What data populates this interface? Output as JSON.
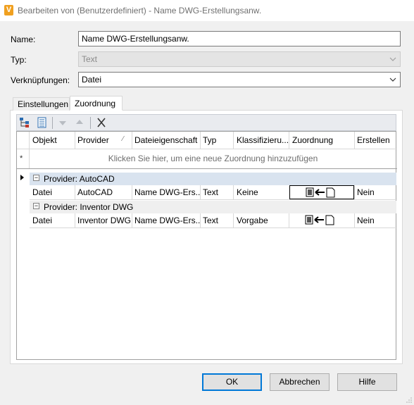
{
  "window": {
    "title": "Bearbeiten von (Benutzerdefiniert) - Name DWG-Erstellungsanw.",
    "app_icon_letter": "V"
  },
  "form": {
    "name_label": "Name:",
    "name_value": "Name DWG-Erstellungsanw.",
    "type_label": "Typ:",
    "type_value": "Text",
    "links_label": "Verknüpfungen:",
    "links_value": "Datei"
  },
  "tabs": [
    {
      "label": "Einstellungen",
      "active": false
    },
    {
      "label": "Zuordnung",
      "active": true
    }
  ],
  "grid": {
    "columns": [
      "Objekt",
      "Provider",
      "Dateieigenschaft",
      "Typ",
      "Klassifizieru...",
      "Zuordnung",
      "Erstellen"
    ],
    "new_row_marker": "*",
    "new_row_hint": "Klicken Sie hier, um eine neue Zuordnung hinzuzufügen",
    "groups": [
      {
        "header": "Provider: AutoCAD",
        "selected": true,
        "rows": [
          {
            "objekt": "Datei",
            "provider": "AutoCAD",
            "eigenschaft": "Name DWG-Ers...",
            "typ": "Text",
            "klass": "Keine",
            "erstellen": "Nein"
          }
        ]
      },
      {
        "header": "Provider: Inventor DWG",
        "selected": false,
        "rows": [
          {
            "objekt": "Datei",
            "provider": "Inventor DWG",
            "eigenschaft": "Name DWG-Ers...",
            "typ": "Text",
            "klass": "Vorgabe",
            "erstellen": "Nein"
          }
        ]
      }
    ]
  },
  "buttons": {
    "ok": "OK",
    "cancel": "Abbrechen",
    "help": "Hilfe"
  },
  "colors": {
    "group_selected": "#d9e3ef",
    "group_normal": "#efefef",
    "accent": "#0078d7"
  }
}
